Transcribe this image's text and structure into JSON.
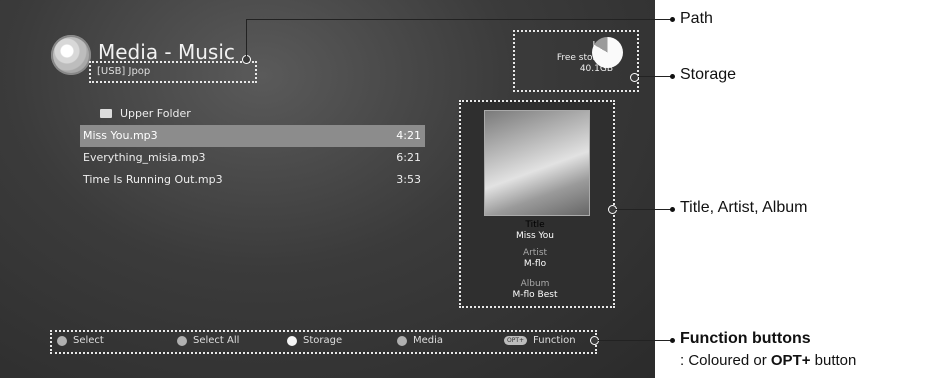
{
  "header": {
    "title": "Media - Music",
    "path": "[USB] Jpop"
  },
  "storage": {
    "device": "USB",
    "free_label": "Free storage",
    "free_value": "40.1GB"
  },
  "list": {
    "upper_folder": "Upper Folder",
    "items": [
      {
        "name": "Miss You.mp3",
        "duration": "4:21",
        "selected": true
      },
      {
        "name": "Everything_misia.mp3",
        "duration": "6:21",
        "selected": false
      },
      {
        "name": "Time Is Running Out.mp3",
        "duration": "3:53",
        "selected": false
      }
    ]
  },
  "info": {
    "title_label": "Title",
    "title": "Miss You",
    "artist_label": "Artist",
    "artist": "M-flo",
    "album_label": "Album",
    "album": "M-flo Best"
  },
  "function_bar": {
    "select": "Select",
    "select_all": "Select All",
    "storage": "Storage",
    "media": "Media",
    "opt_badge": "OPT+",
    "function": "Function"
  },
  "annotations": {
    "path": "Path",
    "storage": "Storage",
    "title_artist_album": "Title, Artist, Album",
    "function_buttons": "Function buttons",
    "function_buttons_sub_prefix": ": Coloured or ",
    "function_buttons_sub_bold": "OPT+",
    "function_buttons_sub_suffix": " button"
  }
}
